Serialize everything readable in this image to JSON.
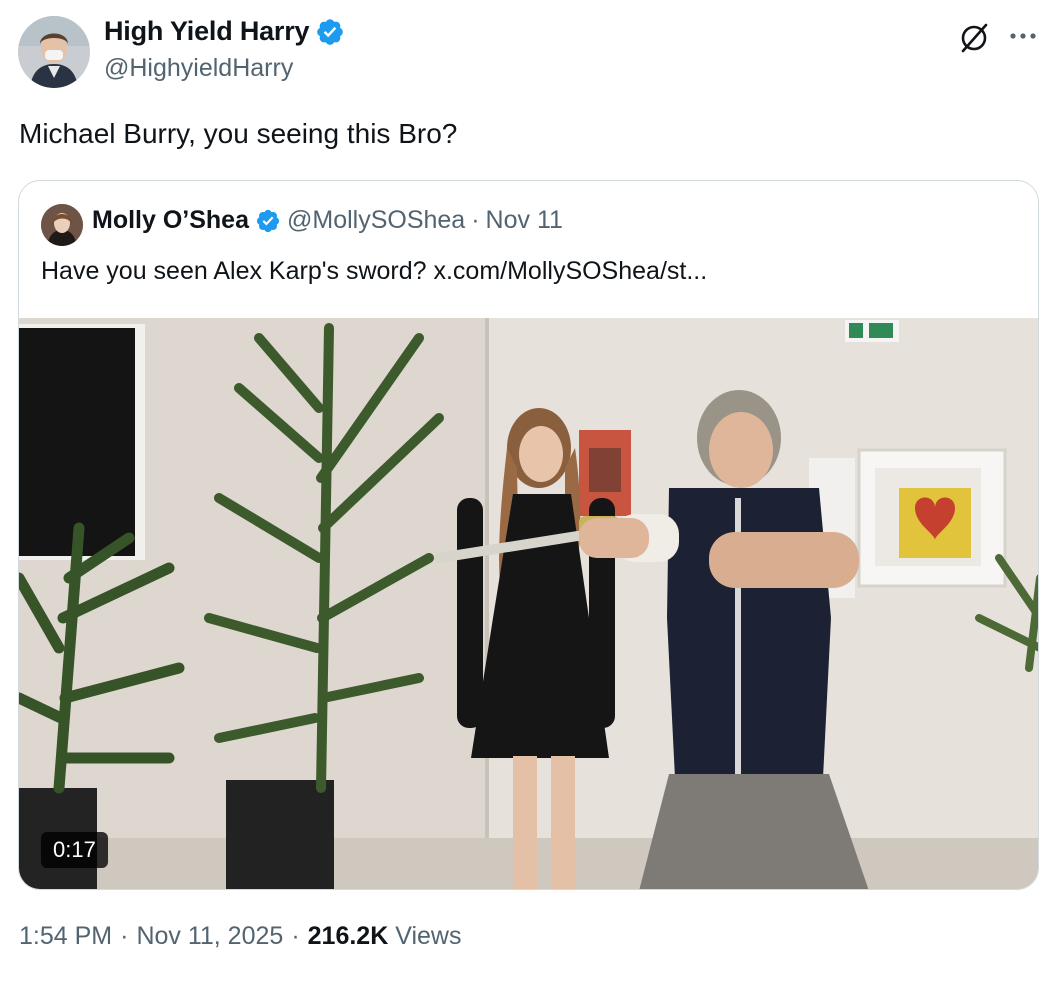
{
  "author": {
    "display_name": "High Yield Harry",
    "handle": "@HighyieldHarry",
    "verified": true
  },
  "tweet": {
    "text": "Michael Burry, you seeing this Bro?"
  },
  "quote": {
    "display_name": "Molly O’Shea",
    "handle": "@MollySOShea",
    "separator": "·",
    "date": "Nov 11",
    "text": "Have you seen Alex Karp's sword?  x.com/MollySOShea/st...",
    "video": {
      "duration": "0:17"
    }
  },
  "footer": {
    "time": "1:54 PM",
    "sep1": "·",
    "date": "Nov 11, 2025",
    "sep2": "·",
    "views_count": "216.2K",
    "views_label": "Views"
  },
  "colors": {
    "primary_text": "#0f1419",
    "secondary_text": "#536471",
    "verified_blue": "#1d9bf0",
    "border": "#cfd9de"
  },
  "icons": [
    "verified-badge-icon",
    "grok-icon",
    "more-options-icon"
  ]
}
